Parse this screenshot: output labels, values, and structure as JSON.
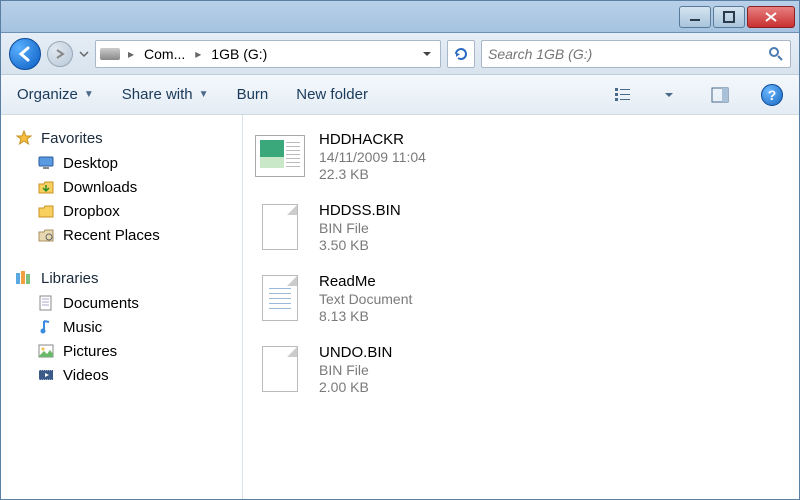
{
  "breadcrumb": {
    "seg1": "Com...",
    "seg2": "1GB (G:)"
  },
  "search": {
    "placeholder": "Search 1GB (G:)"
  },
  "toolbar": {
    "organize": "Organize",
    "share": "Share with",
    "burn": "Burn",
    "newfolder": "New folder"
  },
  "sidebar": {
    "favorites": "Favorites",
    "items_fav": [
      "Desktop",
      "Downloads",
      "Dropbox",
      "Recent Places"
    ],
    "libraries": "Libraries",
    "items_lib": [
      "Documents",
      "Music",
      "Pictures",
      "Videos"
    ]
  },
  "files": [
    {
      "name": "HDDHACKR",
      "line2": "14/11/2009 11:04",
      "line3": "22.3 KB",
      "icon": "app"
    },
    {
      "name": "HDDSS.BIN",
      "line2": "BIN File",
      "line3": "3.50 KB",
      "icon": "blank"
    },
    {
      "name": "ReadMe",
      "line2": "Text Document",
      "line3": "8.13 KB",
      "icon": "text"
    },
    {
      "name": "UNDO.BIN",
      "line2": "BIN File",
      "line3": "2.00 KB",
      "icon": "blank"
    }
  ]
}
